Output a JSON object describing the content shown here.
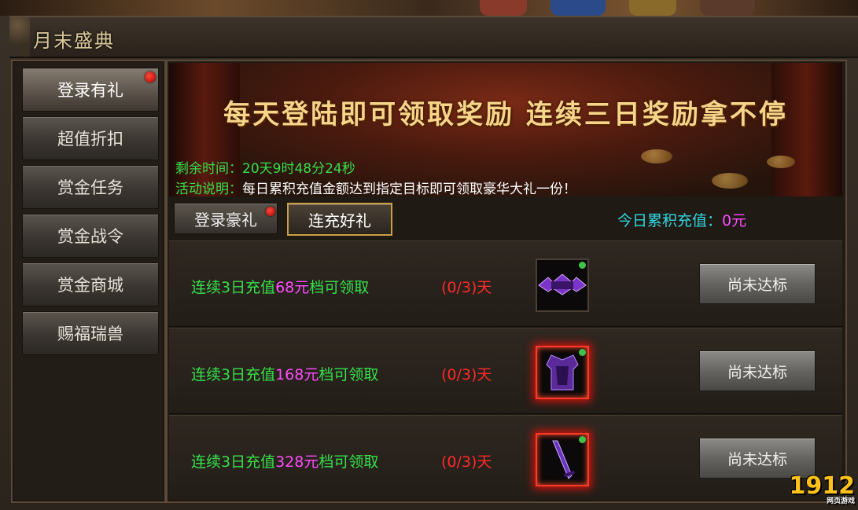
{
  "window": {
    "title": "月末盛典"
  },
  "sidebar": {
    "items": [
      {
        "label": "登录有礼",
        "active": true,
        "badge": true
      },
      {
        "label": "超值折扣",
        "active": false,
        "badge": false
      },
      {
        "label": "赏金任务",
        "active": false,
        "badge": false
      },
      {
        "label": "赏金战令",
        "active": false,
        "badge": false
      },
      {
        "label": "赏金商城",
        "active": false,
        "badge": false
      },
      {
        "label": "赐福瑞兽",
        "active": false,
        "badge": false
      }
    ]
  },
  "banner": {
    "headline": "每天登陆即可领取奖励 连续三日奖励拿不停",
    "remaining_label": "剩余时间：",
    "remaining_value": "20天9时48分24秒",
    "desc_label": "活动说明：",
    "desc_value": "每日累积充值金额达到指定目标即可领取豪华大礼一份！"
  },
  "tabs": [
    {
      "label": "登录豪礼",
      "active": false,
      "badge": true
    },
    {
      "label": "连充好礼",
      "active": true,
      "badge": false
    }
  ],
  "today_recharge": {
    "label": "今日累积充值：",
    "value": "0元"
  },
  "rewards": [
    {
      "prefix": "连续3日充值",
      "amount": "68元",
      "suffix": "档可领取",
      "progress": "(0/3)天",
      "item_icon": "purple-title-emblem-icon",
      "button": "尚未达标"
    },
    {
      "prefix": "连续3日充值",
      "amount": "168元",
      "suffix": "档可领取",
      "progress": "(0/3)天",
      "item_icon": "purple-armor-icon",
      "button": "尚未达标"
    },
    {
      "prefix": "连续3日充值",
      "amount": "328元",
      "suffix": "档可领取",
      "progress": "(0/3)天",
      "item_icon": "purple-sword-icon",
      "button": "尚未达标"
    }
  ],
  "watermark": {
    "logo": "1912",
    "sub": "网页游戏"
  },
  "colors": {
    "green_text": "#35e04a",
    "magenta_text": "#ff4bff",
    "red_text": "#ff2a2a",
    "cyan_text": "#32d7e0",
    "gold": "#f6d58a"
  }
}
